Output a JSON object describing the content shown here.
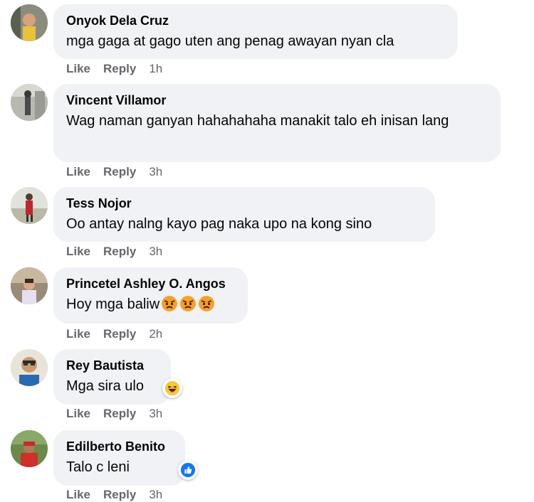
{
  "comments": [
    {
      "author": "Onyok Dela Cruz",
      "text": "mga gaga at gago uten ang penag awayan nyan cla",
      "like": "Like",
      "reply": "Reply",
      "time": "1h"
    },
    {
      "author": "Vincent Villamor",
      "text": "Wag naman ganyan hahahahaha manakit talo eh inisan lang",
      "like": "Like",
      "reply": "Reply",
      "time": "3h"
    },
    {
      "author": "Tess Nojor",
      "text": "Oo antay nalng kayo pag naka upo na kong sino",
      "like": "Like",
      "reply": "Reply",
      "time": "3h"
    },
    {
      "author": "Princetel Ashley O. Angos",
      "text": "Hoy mga baliw",
      "emojis": [
        "angry-face-icon",
        "angry-face-icon",
        "angry-face-icon"
      ],
      "like": "Like",
      "reply": "Reply",
      "time": "2h"
    },
    {
      "author": "Rey Bautista",
      "text": "Mga sira ulo",
      "reaction": "haha-reaction-icon",
      "like": "Like",
      "reply": "Reply",
      "time": "3h"
    },
    {
      "author": "Edilberto Benito",
      "text": "Talo c leni",
      "reaction": "like-reaction-icon",
      "like": "Like",
      "reply": "Reply",
      "time": "3h"
    }
  ],
  "colors": {
    "bubble": "#f0f2f5",
    "meta": "#65676b",
    "like_blue": "#1877f2",
    "text": "#050505"
  }
}
